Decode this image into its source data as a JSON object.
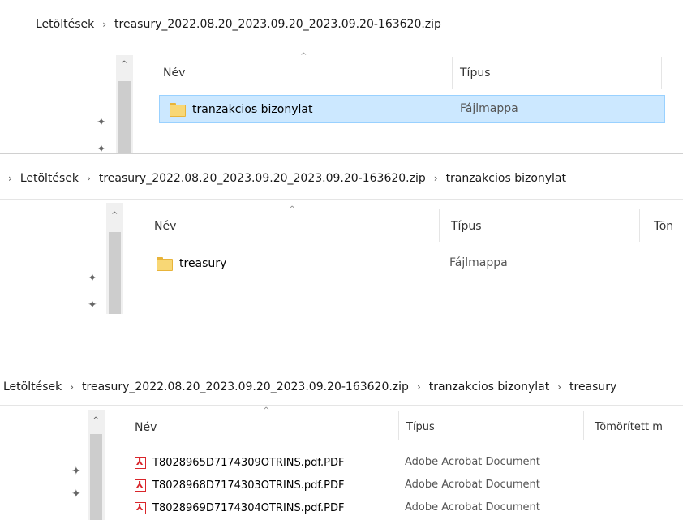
{
  "panel1": {
    "breadcrumb": [
      "Letöltések",
      "treasury_2022.08.20_2023.09.20_2023.09.20-163620.zip"
    ],
    "columns": {
      "name": "Név",
      "type": "Típus"
    },
    "rows": [
      {
        "name": "tranzakcios bizonylat",
        "type": "Fájlmappa",
        "icon": "folder-icon",
        "selected": true
      }
    ]
  },
  "panel2": {
    "breadcrumb": [
      "Letöltések",
      "treasury_2022.08.20_2023.09.20_2023.09.20-163620.zip",
      "tranzakcios bizonylat"
    ],
    "columns": {
      "name": "Név",
      "type": "Típus",
      "compressed": "Tön"
    },
    "rows": [
      {
        "name": "treasury",
        "type": "Fájlmappa",
        "icon": "folder-icon"
      }
    ]
  },
  "panel3": {
    "breadcrumb": [
      "Letöltések",
      "treasury_2022.08.20_2023.09.20_2023.09.20-163620.zip",
      "tranzakcios bizonylat",
      "treasury"
    ],
    "columns": {
      "name": "Név",
      "type": "Típus",
      "compressed": "Tömörített m"
    },
    "rows": [
      {
        "name": "T8028965D7174309OTRINS.pdf.PDF",
        "type": "Adobe Acrobat Document",
        "icon": "pdf-icon"
      },
      {
        "name": "T8028968D7174303OTRINS.pdf.PDF",
        "type": "Adobe Acrobat Document",
        "icon": "pdf-icon"
      },
      {
        "name": "T8028969D7174304OTRINS.pdf.PDF",
        "type": "Adobe Acrobat Document",
        "icon": "pdf-icon"
      }
    ]
  },
  "glyphs": {
    "sep": "›",
    "up": "^",
    "sort": "^",
    "pin": "✦",
    "pdf": "⅄"
  }
}
